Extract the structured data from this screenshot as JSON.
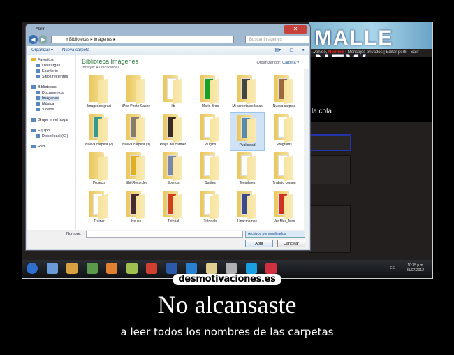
{
  "website": {
    "logo": "MALLE NEW",
    "nav": [
      "...venido, ",
      "Nombre",
      " | Mensajes privados | Editar perfil | Salir"
    ],
    "tagline": "la cola"
  },
  "dialog": {
    "title": "Abrir",
    "address": "« Bibliotecas ▸ Imágenes ▸",
    "search_placeholder": "Buscar Imágenes",
    "toolbar": {
      "organize": "Organizar ▾",
      "new_folder": "Nueva carpeta"
    },
    "sidebar": [
      {
        "label": "Favoritos",
        "group": true
      },
      {
        "label": "Descargas"
      },
      {
        "label": "Escritorio"
      },
      {
        "label": "Sitios recientes"
      },
      {
        "label": "Bibliotecas",
        "group": true
      },
      {
        "label": "Documentos"
      },
      {
        "label": "Imágenes",
        "selected": true
      },
      {
        "label": "Música"
      },
      {
        "label": "Vídeos"
      },
      {
        "label": "Grupo en el hogar",
        "group": true
      },
      {
        "label": "Equipo",
        "group": true
      },
      {
        "label": "Disco local (C:)"
      },
      {
        "label": "Red",
        "group": true
      }
    ],
    "library_title": "Biblioteca Imágenes",
    "library_subtitle": "Incluye: 4 ubicaciones",
    "arrange_label": "Organizar por:",
    "arrange_value": "Carpeta ▾",
    "folders": [
      {
        "name": "Imagenes graci"
      },
      {
        "name": "iPod Photo Cache"
      },
      {
        "name": "lib",
        "thumb": "#ffffff"
      },
      {
        "name": "Mario Bros",
        "thumb": "#18a020"
      },
      {
        "name": "Mi carpeta de losas",
        "thumb": "#444444"
      },
      {
        "name": "Nueva carpeta",
        "thumb": "#9a6a3a"
      },
      {
        "name": "Nueva carpeta (2)",
        "thumb": "#3a9a8a"
      },
      {
        "name": "Nueva carpeta (3)",
        "thumb": "#8a7a6a"
      },
      {
        "name": "Playa del carmen",
        "thumb": "#3a2a22"
      },
      {
        "name": "Plugins",
        "thumb": "#ffffff"
      },
      {
        "name": "Publicidad",
        "thumb": "#5a8aaa",
        "selected": true
      },
      {
        "name": "Programs",
        "thumb": "#ffffff"
      },
      {
        "name": "Projects"
      },
      {
        "name": "ShiftRecorder",
        "thumb": "#e0b020"
      },
      {
        "name": "Sounds",
        "thumb": "#7788aa"
      },
      {
        "name": "Sprites",
        "thumb": "#ffffff"
      },
      {
        "name": "Templates",
        "thumb": "#ffffff"
      },
      {
        "name": "Trabajo compu",
        "thumb": "#ffffff"
      },
      {
        "name": "Trainer",
        "thumb": "#ffffff"
      },
      {
        "name": "Issues",
        "thumb": "#4a2a2a"
      },
      {
        "name": "Tutorial",
        "thumb": "#d04020"
      },
      {
        "name": "Tutorials",
        "thumb": "#ffffff"
      },
      {
        "name": "Unacmemes",
        "thumb": "#3a4a8a"
      },
      {
        "name": "Ver Más_Mas",
        "thumb": "#d03020"
      }
    ],
    "filename_label": "Nombre:",
    "filename_value": "",
    "filter": "Archivos personalizados",
    "open_button": "Abrir",
    "cancel_button": "Cancelar"
  },
  "taskbar": {
    "tray": "ES",
    "time": "10:35 p.m.",
    "date": "31/07/2012",
    "icon_colors": [
      "#2f6fd0",
      "#6a9ad8",
      "#d8a040",
      "#5a9a4a",
      "#e08030",
      "#a0c050",
      "#d04030",
      "#2a5aa8",
      "#2a80d0",
      "#e0d090",
      "#b0b0b0",
      "#1aa0e0",
      "#d03040"
    ]
  },
  "brand": "desmotivaciones.es",
  "poster": {
    "title": "No alcansaste",
    "subtitle": "a leer todos los nombres de las carpetas"
  }
}
